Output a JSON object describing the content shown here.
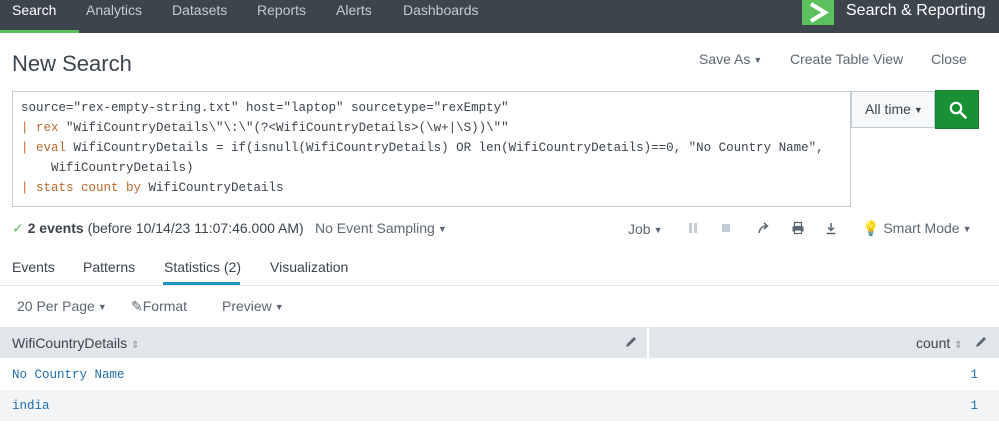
{
  "nav": {
    "items": [
      "Search",
      "Analytics",
      "Datasets",
      "Reports",
      "Alerts",
      "Dashboards"
    ],
    "app_name": "Search & Reporting"
  },
  "header": {
    "title": "New Search",
    "save_as": "Save As",
    "create_table_view": "Create Table View",
    "close": "Close"
  },
  "search": {
    "query_lines": [
      "source=\"rex-empty-string.txt\" host=\"laptop\" sourcetype=\"rexEmpty\"",
      "| rex \"WifiCountryDetails\\\"\\:\\\"(?<WifiCountryDetails>(\\w+|\\S))\\\"\"",
      "| eval WifiCountryDetails = if(isnull(WifiCountryDetails) OR len(WifiCountryDetails)==0, \"No Country Name\",",
      "    WifiCountryDetails)",
      "| stats count by WifiCountryDetails"
    ],
    "time_range": "All time"
  },
  "status": {
    "event_count": "2 events",
    "time_note": "(before 10/14/23 11:07:46.000 AM)",
    "sampling": "No Event Sampling",
    "job": "Job",
    "mode": "Smart Mode"
  },
  "tabs": [
    "Events",
    "Patterns",
    "Statistics (2)",
    "Visualization"
  ],
  "toolbar": {
    "per_page": "20 Per Page",
    "format": "Format",
    "preview": "Preview"
  },
  "table": {
    "columns": [
      "WifiCountryDetails",
      "count"
    ],
    "rows": [
      [
        "No Country Name",
        "1"
      ],
      [
        "india",
        "1"
      ]
    ]
  },
  "colors": {
    "nav_bg": "#3c444d",
    "accent_green": "#5cc05c",
    "search_green": "#1a9035",
    "tab_blue": "#1e93c6",
    "value_blue": "#1e6fb0"
  }
}
